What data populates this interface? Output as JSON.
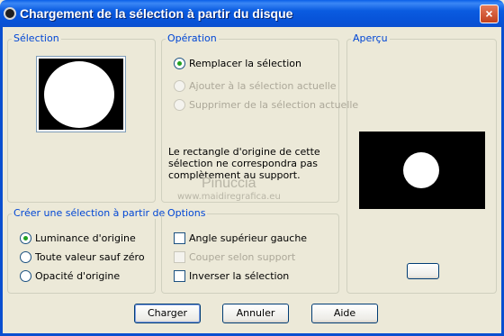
{
  "window": {
    "title": "Chargement de la sélection à partir du disque",
    "close_glyph": "×"
  },
  "selection_group": {
    "title": "Sélection"
  },
  "operation_group": {
    "title": "Opération",
    "options": [
      {
        "label": "Remplacer la sélection",
        "checked": true,
        "enabled": true
      },
      {
        "label": "Ajouter à la sélection actuelle",
        "checked": false,
        "enabled": false
      },
      {
        "label": "Supprimer de la sélection actuelle",
        "checked": false,
        "enabled": false
      }
    ],
    "note": "Le rectangle d'origine de cette sélection ne correspondra pas complètement au support."
  },
  "preview_group": {
    "title": "Aperçu"
  },
  "create_group": {
    "title": "Créer une sélection à partir de :",
    "options": [
      {
        "label": "Luminance d'origine",
        "checked": true
      },
      {
        "label": "Toute valeur sauf zéro",
        "checked": false
      },
      {
        "label": "Opacité d'origine",
        "checked": false
      }
    ]
  },
  "options_group": {
    "title": "Options",
    "checks": [
      {
        "label": "Angle supérieur gauche",
        "checked": false,
        "enabled": true
      },
      {
        "label": "Couper selon support",
        "checked": false,
        "enabled": false
      },
      {
        "label": "Inverser la sélection",
        "checked": false,
        "enabled": true
      }
    ]
  },
  "buttons": {
    "load": "Charger",
    "cancel": "Annuler",
    "help": "Aide"
  },
  "watermark": {
    "line1": "Pinuccia",
    "line2": "www.maidiregrafica.eu"
  }
}
